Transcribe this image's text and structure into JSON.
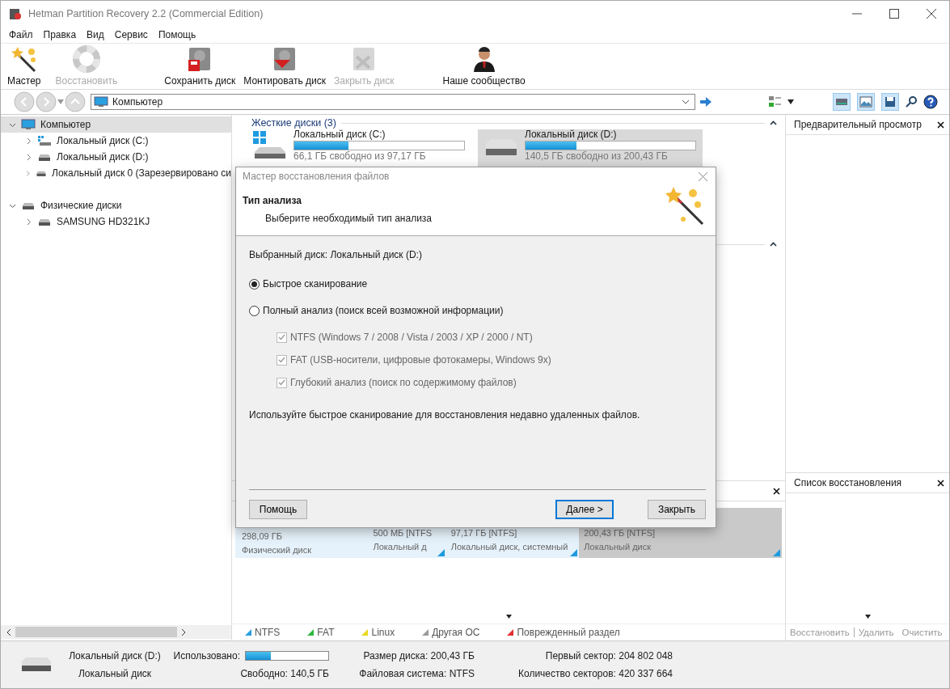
{
  "window": {
    "title": "Hetman Partition Recovery 2.2 (Commercial Edition)"
  },
  "menu": [
    "Файл",
    "Правка",
    "Вид",
    "Сервис",
    "Помощь"
  ],
  "toolbar": [
    {
      "label": "Мастер",
      "kind": "wand",
      "disabled": false
    },
    {
      "label": "Восстановить",
      "kind": "lifebuoy",
      "disabled": true
    },
    {
      "label": "Сохранить диск",
      "kind": "save-disk",
      "disabled": false
    },
    {
      "label": "Монтировать диск",
      "kind": "mount-disk",
      "disabled": false
    },
    {
      "label": "Закрыть диск",
      "kind": "close-disk",
      "disabled": true
    },
    {
      "label": "Наше сообщество",
      "kind": "person",
      "disabled": false
    }
  ],
  "address": {
    "value": "Компьютер"
  },
  "view_toggles": [
    {
      "kind": "drive",
      "selected": true
    },
    {
      "kind": "preview",
      "selected": true
    },
    {
      "kind": "save",
      "selected": true
    }
  ],
  "tree": [
    {
      "label": "Компьютер",
      "kind": "computer",
      "expanded": true,
      "selected": true,
      "children": [
        {
          "label": "Локальный диск (C:)",
          "kind": "windows-drive",
          "expanded": false,
          "selected": false
        },
        {
          "label": "Локальный диск (D:)",
          "kind": "drive",
          "expanded": false,
          "selected": false
        },
        {
          "label": "Локальный диск 0 (Зарезервировано си",
          "kind": "drive",
          "expanded": false,
          "selected": false
        }
      ]
    },
    {
      "label": "Физические диски",
      "kind": "drive",
      "expanded": true,
      "selected": false,
      "children": [
        {
          "label": "SAMSUNG HD321KJ",
          "kind": "drive",
          "expanded": false,
          "selected": false
        }
      ]
    }
  ],
  "hard_disks": {
    "title": "Жесткие диски (3)",
    "disks": [
      {
        "name": "Локальный диск (C:)",
        "kind": "windows-drive",
        "level": 0.32,
        "free": "66,1 ГБ свободно из 97,17 ГБ",
        "selected": false
      },
      {
        "name": "Локальный диск (D:)",
        "kind": "drive",
        "level": 0.3,
        "free": "140,5 ГБ свободно из 200,43 ГБ",
        "selected": true
      }
    ]
  },
  "disk_map": {
    "physical": {
      "size": "298,09 ГБ",
      "type": "Физический диск"
    },
    "partitions": [
      {
        "size": "500 МБ [NTFS",
        "label": "Локальный д",
        "selected": false
      },
      {
        "size": "97,17 ГБ [NTFS]",
        "label": "Локальный диск, системный",
        "selected": false
      },
      {
        "size": "200,43 ГБ [NTFS]",
        "label": "Локальный диск",
        "selected": true
      }
    ]
  },
  "legend": [
    {
      "label": "NTFS",
      "color": "#2a9ee0"
    },
    {
      "label": "FAT",
      "color": "#2db83d"
    },
    {
      "label": "Linux",
      "color": "#e8d820"
    },
    {
      "label": "Другая ОС",
      "color": "#9a9a9a"
    },
    {
      "label": "Поврежденный раздел",
      "color": "#e03030"
    }
  ],
  "preview": {
    "title": "Предварительный просмотр"
  },
  "recovery_list": {
    "title": "Список восстановления",
    "buttons": [
      {
        "label": "Восстановить",
        "disabled": true
      },
      {
        "label": "Удалить",
        "disabled": true
      },
      {
        "label": "Очистить",
        "disabled": true
      }
    ]
  },
  "status_bar": {
    "name": "Локальный диск (D:)",
    "type": "Локальный диск",
    "used_label": "Использовано:",
    "used": {
      "level": 0.3
    },
    "free": "Свободно: 140,5 ГБ",
    "size": "Размер диска: 200,43 ГБ",
    "filesystem": "Файловая система: NTFS",
    "first_sector": "Первый сектор: 204 802 048",
    "sectors": "Количество секторов: 420 337 664"
  },
  "dialog": {
    "title": "Мастер восстановления файлов",
    "heading": "Тип анализа",
    "subheading": "Выберите необходимый тип анализа",
    "selected_disk": "Выбранный диск: Локальный диск (D:)",
    "options": [
      {
        "kind": "radio",
        "label": "Быстрое сканирование",
        "selected": true
      },
      {
        "kind": "radio",
        "label": "Полный анализ (поиск всей возможной информации)",
        "selected": false
      },
      {
        "kind": "checkbox",
        "label": "NTFS (Windows 7 / 2008 / Vista / 2003 / XP / 2000 / NT)",
        "checked": true,
        "disabled": true
      },
      {
        "kind": "checkbox",
        "label": "FAT (USB-носители, цифровые фотокамеры, Windows 9x)",
        "checked": true,
        "disabled": true
      },
      {
        "kind": "checkbox",
        "label": "Глубокий анализ (поиск по содержимому файлов)",
        "checked": true,
        "disabled": true
      }
    ],
    "note": "Используйте быстрое сканирование для восстановления недавно удаленных файлов.",
    "buttons": [
      {
        "label": "Помощь",
        "kind": "help",
        "focused": false
      },
      {
        "label": "Далее >",
        "kind": "next",
        "focused": true
      },
      {
        "label": "Закрыть",
        "kind": "close",
        "focused": false
      }
    ]
  }
}
